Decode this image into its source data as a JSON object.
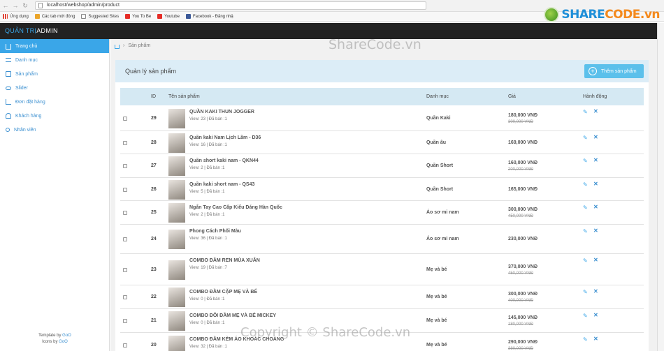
{
  "browser": {
    "url": "localhost/webshop/admin/product",
    "bookmarks": [
      {
        "icon": "apps-icon",
        "label": "Ứng dụng"
      },
      {
        "icon": "bookmark-icon",
        "label": "Các tab mới đóng"
      },
      {
        "icon": "page-icon",
        "label": "Suggested Sites"
      },
      {
        "icon": "youtube-icon",
        "label": "You To Be"
      },
      {
        "icon": "youtube-icon",
        "label": "Youtube"
      },
      {
        "icon": "facebook-icon",
        "label": "Facebook - Đăng nhậ"
      }
    ]
  },
  "logo": {
    "part1": "SHARE",
    "part2": "CODE.vn"
  },
  "header": {
    "brand_left": "QUẢN TRỊ",
    "brand_right": "ADMIN"
  },
  "sidebar": {
    "items": [
      {
        "label": "Trang chủ",
        "icon": "home-icon",
        "active": true
      },
      {
        "label": "Danh mục",
        "icon": "list-icon"
      },
      {
        "label": "Sản phẩm",
        "icon": "bag-icon"
      },
      {
        "label": "Slider",
        "icon": "slider-icon"
      },
      {
        "label": "Đơn đặt hàng",
        "icon": "cart-icon"
      },
      {
        "label": "Khách hàng",
        "icon": "users-icon"
      },
      {
        "label": "Nhân viên",
        "icon": "user-icon"
      }
    ],
    "footer_line1_prefix": "Template by ",
    "footer_line1_link": "GoO",
    "footer_line2_prefix": "Icons by ",
    "footer_line2_link": "GoO"
  },
  "breadcrumb": {
    "current": "Sản phẩm"
  },
  "panel": {
    "title": "Quản lý sản phẩm",
    "add_label": "Thêm sản phẩm"
  },
  "table": {
    "headers": [
      "ID",
      "Tên sản phẩm",
      "Danh mục",
      "Giá",
      "Hành động"
    ],
    "rows": [
      {
        "id": "29",
        "name": "QUẦN KAKI THUN JOGGER",
        "meta": "View: 23 | Đã bán :1",
        "category": "Quần Kaki",
        "price": "180,000 VNĐ",
        "old_price": "300,000 VNĐ"
      },
      {
        "id": "28",
        "name": "Quần kaki Nam Lịch Lãm - D36",
        "meta": "View: 16 | Đã bán :1",
        "category": "Quần âu",
        "price": "169,000 VNĐ",
        "old_price": ""
      },
      {
        "id": "27",
        "name": "Quần short kaki nam - QKN44",
        "meta": "View: 2 | Đã bán :1",
        "category": "Quần Short",
        "price": "160,000 VNĐ",
        "old_price": "200,000 VNĐ"
      },
      {
        "id": "26",
        "name": "Quần kaki short nam - QS43",
        "meta": "View: 5 | Đã bán :1",
        "category": "Quần Short",
        "price": "165,000 VNĐ",
        "old_price": ""
      },
      {
        "id": "25",
        "name": "Ngắn Tay Cao Cấp Kiểu Dáng Hàn Quốc",
        "meta": "View: 2 | Đã bán :1",
        "category": "Áo sơ mi nam",
        "price": "300,000 VNĐ",
        "old_price": "450,000 VNĐ"
      },
      {
        "id": "24",
        "name": "Phong Cách Phối Màu",
        "meta": "View: 36 | Đã bán :1",
        "category": "Áo sơ mi nam",
        "price": "230,000 VNĐ",
        "old_price": ""
      },
      {
        "id": "23",
        "name": "COMBO ĐẦM REN MÙA XUÂN",
        "meta": "View: 19 | Đã bán :7",
        "category": "Mẹ và bé",
        "price": "370,000 VNĐ",
        "old_price": "450,000 VNĐ"
      },
      {
        "id": "22",
        "name": "COMBO ĐẦM CẶP MẸ VÀ BÉ",
        "meta": "View: 0 | Đã bán :1",
        "category": "Mẹ và bé",
        "price": "300,000 VNĐ",
        "old_price": "400,000 VNĐ"
      },
      {
        "id": "21",
        "name": "COMBO ĐÔI ĐẦM MẸ VÀ BÉ MICKEY",
        "meta": "View: 0 | Đã bán :1",
        "category": "Mẹ và bé",
        "price": "145,000 VNĐ",
        "old_price": "180,000 VNĐ"
      },
      {
        "id": "20",
        "name": "COMBO ĐẦM KÈM ÁO KHOÁC CHOÀNG",
        "meta": "View: 32 | Đã bán :1",
        "category": "Mẹ và bé",
        "price": "290,000 VNĐ",
        "old_price": "380,000 VNĐ"
      }
    ]
  },
  "watermarks": {
    "top": "ShareCode.vn",
    "bottom": "Copyright © ShareCode.vn"
  },
  "colors": {
    "accent": "#3aa6e8",
    "header_bg": "#222222",
    "panel_head": "#dcedf7"
  }
}
